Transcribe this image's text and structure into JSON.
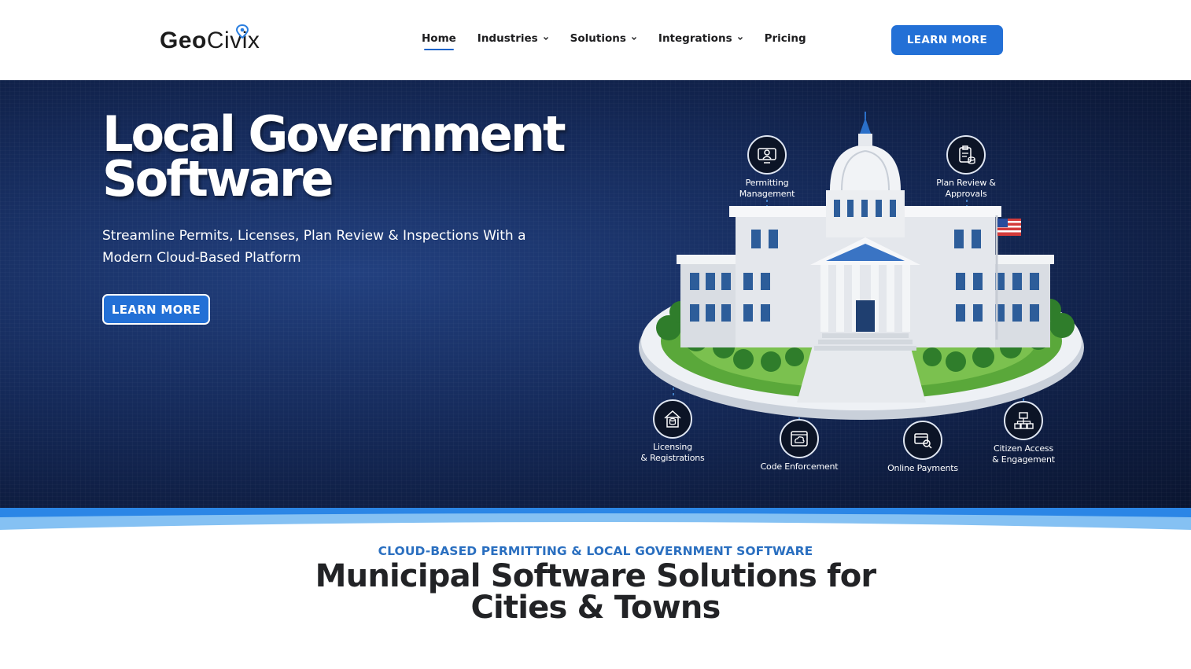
{
  "brand": {
    "logo_geo": "Geo",
    "logo_civix": "Civix"
  },
  "nav": {
    "items": [
      {
        "label": "Home",
        "active": true,
        "dropdown": false
      },
      {
        "label": "Industries",
        "active": false,
        "dropdown": true
      },
      {
        "label": "Solutions",
        "active": false,
        "dropdown": true
      },
      {
        "label": "Integrations",
        "active": false,
        "dropdown": true
      },
      {
        "label": "Pricing",
        "active": false,
        "dropdown": false
      }
    ],
    "cta_label": "LEARN MORE"
  },
  "hero": {
    "title_line1": "Local Government",
    "title_line2": "Software",
    "subtitle": "Streamline Permits, Licenses, Plan Review & Inspections With a Modern Cloud-Based Platform",
    "cta_label": "LEARN MORE",
    "features": [
      {
        "line1": "Permitting",
        "line2": "Management",
        "icon": "monitor-person-icon"
      },
      {
        "line1": "Plan Review &",
        "line2": "Approvals",
        "icon": "clipboard-check-icon"
      },
      {
        "line1": "Licensing",
        "line2": "& Registrations",
        "icon": "license-house-icon"
      },
      {
        "line1": "Code Enforcement",
        "line2": "",
        "icon": "cloud-window-icon"
      },
      {
        "line1": "Online Payments",
        "line2": "",
        "icon": "payment-search-icon"
      },
      {
        "line1": "Citizen Access",
        "line2": "& Engagement",
        "icon": "network-icon"
      }
    ]
  },
  "section": {
    "eyebrow": "CLOUD-BASED PERMITTING & LOCAL GOVERNMENT SOFTWARE",
    "title": "Municipal Software Solutions for Cities & Towns"
  },
  "colors": {
    "accent": "#2370d6",
    "hero_bg": "#152a5a",
    "eyebrow": "#2a6fc0",
    "wave": "#7fbdf2"
  }
}
